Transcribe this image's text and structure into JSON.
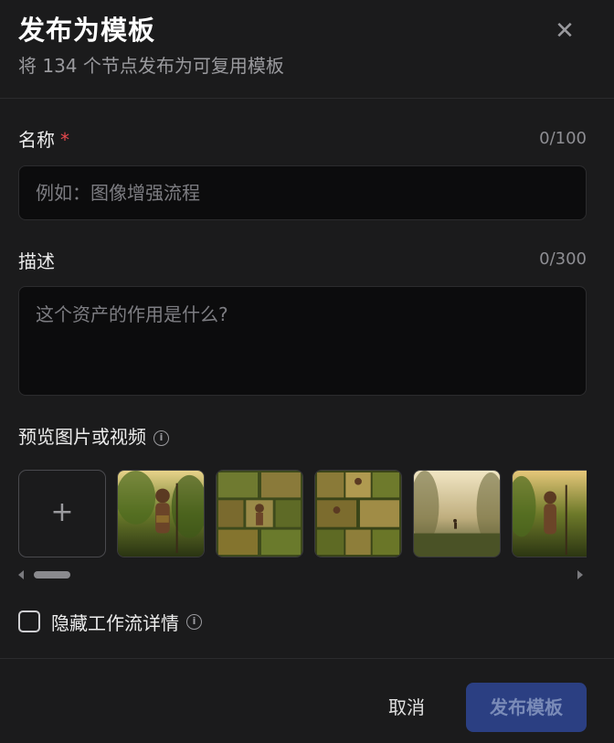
{
  "header": {
    "title": "发布为模板",
    "subtitle": "将 134 个节点发布为可复用模板",
    "close_icon": "close-icon"
  },
  "name_field": {
    "label": "名称",
    "required_mark": "*",
    "counter": "0/100",
    "value": "",
    "placeholder": "例如：图像增强流程"
  },
  "description_field": {
    "label": "描述",
    "counter": "0/300",
    "value": "",
    "placeholder": "这个资产的作用是什么?"
  },
  "preview": {
    "label": "预览图片或视频",
    "info_icon": "info-icon",
    "add_icon": "plus-icon",
    "thumbnail_count": 6
  },
  "hide_details": {
    "label": "隐藏工作流详情",
    "checked": false,
    "info_icon": "info-icon"
  },
  "footer": {
    "cancel_label": "取消",
    "publish_label": "发布模板"
  },
  "colors": {
    "background": "#1b1b1c",
    "input_bg": "#0c0c0d",
    "required": "#e5484d",
    "primary_disabled": "#2b3f82",
    "primary_text_disabled": "#7a8bb8"
  }
}
